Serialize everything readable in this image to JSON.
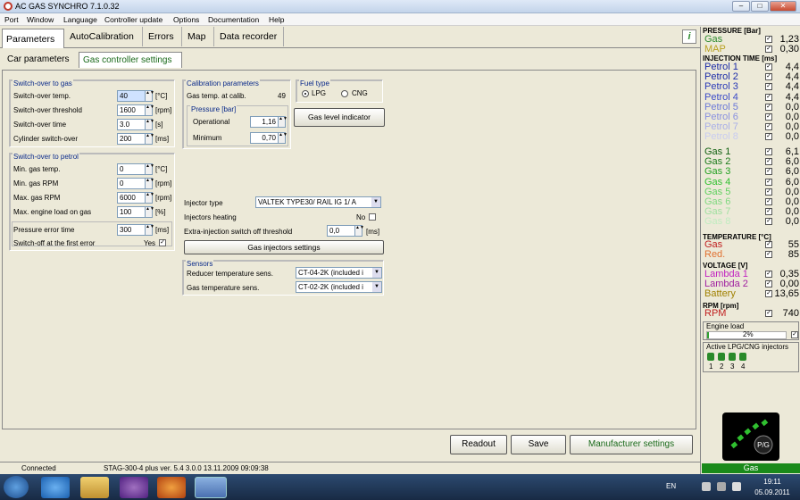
{
  "window": {
    "title": "AC GAS SYNCHRO  7.1.0.32",
    "min": "–",
    "max": "□",
    "close": "✕"
  },
  "menu": [
    "Port",
    "Window",
    "Language",
    "Controller update",
    "Options",
    "Documentation",
    "Help"
  ],
  "tabs": [
    "Parameters",
    "AutoCalibration",
    "Errors",
    "Map",
    "Data recorder"
  ],
  "subtabs": [
    "Car parameters",
    "Gas controller settings"
  ],
  "help_icon": "i",
  "switch_to_gas": {
    "title": "Switch-over to gas",
    "rows": [
      {
        "label": "Switch-over temp.",
        "value": "40",
        "unit": "[°C]"
      },
      {
        "label": "Switch-over threshold",
        "value": "1600",
        "unit": "[rpm]"
      },
      {
        "label": "Switch-over time",
        "value": "3.0",
        "unit": "[s]"
      },
      {
        "label": "Cylinder switch-over",
        "value": "200",
        "unit": "[ms]"
      }
    ]
  },
  "switch_to_petrol": {
    "title": "Switch-over to petrol",
    "rows": [
      {
        "label": "Min. gas temp.",
        "value": "0",
        "unit": "[°C]"
      },
      {
        "label": "Min. gas RPM",
        "value": "0",
        "unit": "[rpm]"
      },
      {
        "label": "Max. gas RPM",
        "value": "6000",
        "unit": "[rpm]"
      },
      {
        "label": "Max. engine load on gas",
        "value": "100",
        "unit": "[%]"
      },
      {
        "label": "Pressure error time",
        "value": "300",
        "unit": "[ms]"
      }
    ],
    "first_error_label": "Switch-off at the first error",
    "first_error_value": "Yes"
  },
  "calibration": {
    "title": "Calibration parameters",
    "gas_temp_label": "Gas temp. at calib.",
    "gas_temp_value": "49",
    "pressure_title": "Pressure [bar]",
    "operational_label": "Operational",
    "operational_value": "1,16",
    "minimum_label": "Minimum",
    "minimum_value": "0,70"
  },
  "fuel": {
    "title": "Fuel type",
    "lpg": "LPG",
    "cng": "CNG",
    "gas_level_button": "Gas level indicator"
  },
  "injector": {
    "type_label": "Injector type",
    "type_value": "VALTEK TYPE30/ RAIL IG 1/ A",
    "heating_label": "Injectors heating",
    "heating_value": "No",
    "extra_label": "Extra-injection switch off threshold",
    "extra_value": "0,0",
    "extra_unit": "[ms]",
    "settings_button": "Gas injectors settings"
  },
  "sensors": {
    "title": "Sensors",
    "reducer_label": "Reducer temperature sens.",
    "reducer_value": "CT-04-2K (included i",
    "gas_label": "Gas temperature sens.",
    "gas_value": "CT-02-2K (included i"
  },
  "buttons": {
    "readout": "Readout",
    "save": "Save",
    "manufacturer": "Manufacturer settings"
  },
  "status": {
    "connected": "Connected",
    "device": "STAG-300-4 plus  ver. 5.4  3.0.0   13.11.2009 09:09:38"
  },
  "right": {
    "pressure": {
      "title": "PRESSURE [Bar]",
      "rows": [
        {
          "name": "Gas",
          "value": "1,23",
          "color": "#2e8b2e"
        },
        {
          "name": "MAP",
          "value": "0,30",
          "color": "#b8a020"
        }
      ]
    },
    "injection": {
      "title": "INJECTION TIME [ms]",
      "petrol": [
        {
          "name": "Petrol 1",
          "value": "4,4",
          "color": "#1a2aa8"
        },
        {
          "name": "Petrol 2",
          "value": "4,4",
          "color": "#1a2aa8"
        },
        {
          "name": "Petrol 3",
          "value": "4,4",
          "color": "#2a3ab8"
        },
        {
          "name": "Petrol 4",
          "value": "4,4",
          "color": "#3a4ac8"
        },
        {
          "name": "Petrol 5",
          "value": "0,0",
          "color": "#6a78d8"
        },
        {
          "name": "Petrol 6",
          "value": "0,0",
          "color": "#8890e0"
        },
        {
          "name": "Petrol 7",
          "value": "0,0",
          "color": "#a8aee8"
        },
        {
          "name": "Petrol 8",
          "value": "0,0",
          "color": "#c8ccf0"
        }
      ],
      "gas": [
        {
          "name": "Gas 1",
          "value": "6,1",
          "color": "#106010"
        },
        {
          "name": "Gas 2",
          "value": "6,0",
          "color": "#1a7a1a"
        },
        {
          "name": "Gas 3",
          "value": "6,0",
          "color": "#22a022"
        },
        {
          "name": "Gas 4",
          "value": "6,0",
          "color": "#30c030"
        },
        {
          "name": "Gas 5",
          "value": "0,0",
          "color": "#60d060"
        },
        {
          "name": "Gas 6",
          "value": "0,0",
          "color": "#80d880"
        },
        {
          "name": "Gas 7",
          "value": "0,0",
          "color": "#a0e0a0"
        },
        {
          "name": "Gas 8",
          "value": "0,0",
          "color": "#c0ecc0"
        }
      ]
    },
    "temperature": {
      "title": "TEMPERATURE [°C]",
      "rows": [
        {
          "name": "Gas",
          "value": "55",
          "color": "#c02020"
        },
        {
          "name": "Red.",
          "value": "85",
          "color": "#e07030"
        }
      ]
    },
    "voltage": {
      "title": "VOLTAGE [V]",
      "rows": [
        {
          "name": "Lambda 1",
          "value": "0,35",
          "color": "#c020c0"
        },
        {
          "name": "Lambda 2",
          "value": "0,00",
          "color": "#a020a0"
        },
        {
          "name": "Battery",
          "value": "13,65",
          "color": "#a08000"
        }
      ]
    },
    "rpm": {
      "title": "RPM [rpm]",
      "rows": [
        {
          "name": "RPM",
          "value": "740",
          "color": "#c02020"
        }
      ]
    },
    "engine_load": {
      "title": "Engine load",
      "value": "2%",
      "fraction": 0.02
    },
    "injectors": {
      "title": "Active LPG/CNG injectors",
      "labels": [
        "1",
        "2",
        "3",
        "4"
      ]
    },
    "gauge_label": "P/G",
    "bottom": "Gas"
  },
  "taskbar": {
    "lang": "EN",
    "time": "19:11",
    "date": "05.09.2011"
  }
}
